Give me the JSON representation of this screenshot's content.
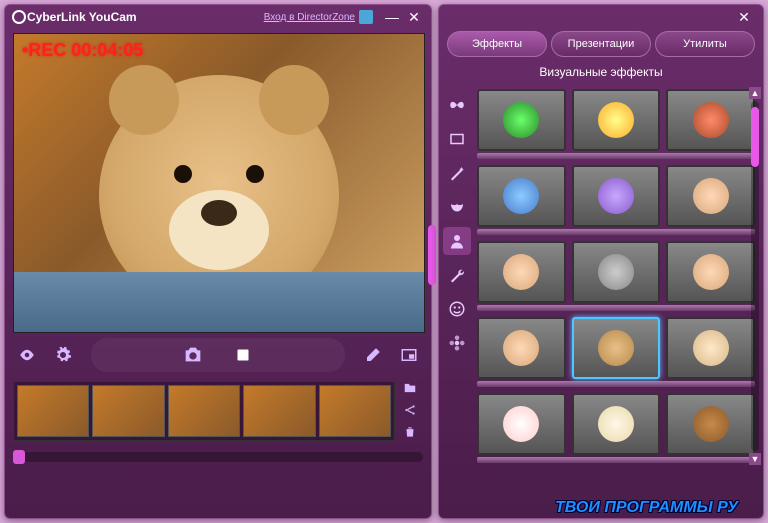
{
  "app": {
    "title": "CyberLink YouCam",
    "dz_link": "Вход в DirectorZone"
  },
  "recording": {
    "overlay": "•REC  00:04:05"
  },
  "controls": {
    "eye": "eye-icon",
    "gear": "gear-icon",
    "camera": "camera-icon",
    "stop": "stop-icon",
    "eraser": "eraser-icon",
    "pip": "pip-icon"
  },
  "timeline": {
    "side_buttons": [
      "folder",
      "share",
      "trash"
    ]
  },
  "right": {
    "tabs": [
      "Эффекты",
      "Презентации",
      "Утилиты"
    ],
    "active_tab": 0,
    "section_title": "Визуальные эффекты",
    "categories": [
      {
        "id": "butterfly",
        "icon": "butterfly-icon"
      },
      {
        "id": "frame",
        "icon": "frame-icon"
      },
      {
        "id": "wand",
        "icon": "wand-icon"
      },
      {
        "id": "mask",
        "icon": "mask-icon"
      },
      {
        "id": "avatar",
        "icon": "avatar-icon",
        "active": true
      },
      {
        "id": "tools",
        "icon": "tools-icon"
      },
      {
        "id": "smiley",
        "icon": "smiley-icon"
      },
      {
        "id": "flower",
        "icon": "flower-icon"
      }
    ],
    "effects": [
      {
        "id": "dl-green",
        "cls": "tf-green"
      },
      {
        "id": "dl-star",
        "cls": "tf-yellow"
      },
      {
        "id": "castle",
        "cls": "tf-red"
      },
      {
        "id": "sky-face",
        "cls": "tf-blue"
      },
      {
        "id": "purple-hat",
        "cls": "tf-purple"
      },
      {
        "id": "girl",
        "cls": "tf-skin"
      },
      {
        "id": "guy",
        "cls": "tf-skin"
      },
      {
        "id": "stone",
        "cls": "tf-gray"
      },
      {
        "id": "fan",
        "cls": "tf-skin"
      },
      {
        "id": "man",
        "cls": "tf-skin"
      },
      {
        "id": "bear",
        "cls": "tf-bear",
        "selected": true
      },
      {
        "id": "bald",
        "cls": "tf-bald"
      },
      {
        "id": "clown",
        "cls": "tf-clown"
      },
      {
        "id": "dog1",
        "cls": "tf-dog1"
      },
      {
        "id": "dog2",
        "cls": "tf-dog2"
      }
    ]
  },
  "watermark": "ТВОИ ПРОГРАММЫ РУ"
}
